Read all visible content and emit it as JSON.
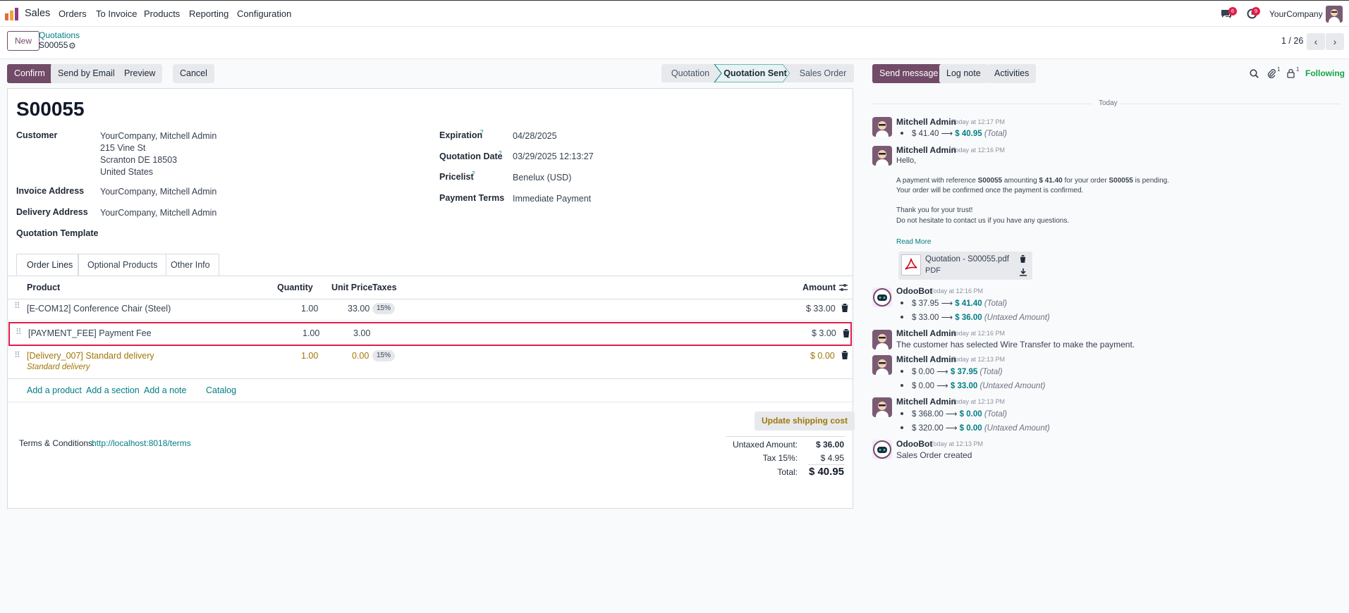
{
  "nav": {
    "app_name": "Sales",
    "menu": [
      "Orders",
      "To Invoice",
      "Products",
      "Reporting",
      "Configuration"
    ],
    "messages_badge": "6",
    "activities_badge": "9",
    "company": "YourCompany"
  },
  "control_panel": {
    "new_label": "New",
    "breadcrumb_parent": "Quotations",
    "record_name": "S00055",
    "pager": "1 / 26"
  },
  "statusbar": {
    "buttons": [
      "Confirm",
      "Send by Email",
      "Preview",
      "Cancel"
    ],
    "stages": [
      "Quotation",
      "Quotation Sent",
      "Sales Order"
    ],
    "active_stage": "Quotation Sent"
  },
  "form": {
    "title": "S00055",
    "customer_label": "Customer",
    "customer_lines": [
      "YourCompany, Mitchell Admin",
      "215 Vine St",
      "Scranton DE 18503",
      "United States"
    ],
    "invoice_address_label": "Invoice Address",
    "invoice_address": "YourCompany, Mitchell Admin",
    "delivery_address_label": "Delivery Address",
    "delivery_address": "YourCompany, Mitchell Admin",
    "quotation_template_label": "Quotation Template",
    "expiration_label": "Expiration",
    "expiration": "04/28/2025",
    "quotation_date_label": "Quotation Date",
    "quotation_date": "03/29/2025 12:13:27",
    "pricelist_label": "Pricelist",
    "pricelist": "Benelux (USD)",
    "payment_terms_label": "Payment Terms",
    "payment_terms": "Immediate Payment",
    "help_mark": "?"
  },
  "tabs": [
    "Order Lines",
    "Optional Products",
    "Other Info"
  ],
  "order_lines": {
    "headers": {
      "product": "Product",
      "quantity": "Quantity",
      "unit_price": "Unit Price",
      "taxes": "Taxes",
      "amount": "Amount"
    },
    "rows": [
      {
        "product": "[E-COM12] Conference Chair (Steel)",
        "quantity": "1.00",
        "unit_price": "33.00",
        "tax": "15%",
        "amount": "$ 33.00"
      },
      {
        "product": "[PAYMENT_FEE] Payment Fee",
        "quantity": "1.00",
        "unit_price": "3.00",
        "tax": "",
        "amount": "$ 3.00"
      },
      {
        "product": "[Delivery_007] Standard delivery",
        "description": "Standard delivery",
        "quantity": "1.00",
        "unit_price": "0.00",
        "tax": "15%",
        "amount": "$ 0.00"
      }
    ],
    "links": [
      "Add a product",
      "Add a section",
      "Add a note",
      "Catalog"
    ]
  },
  "footer": {
    "update_shipping": "Update shipping cost",
    "terms_label": "Terms & Conditions:",
    "terms_link": "http://localhost:8018/terms",
    "untaxed_label": "Untaxed Amount:",
    "untaxed": "$ 36.00",
    "tax_label": "Tax 15%:",
    "tax": "$ 4.95",
    "total_label": "Total:",
    "total": "$ 40.95"
  },
  "chatter": {
    "send_message": "Send message",
    "log_note": "Log note",
    "activities": "Activities",
    "attachments_count": "1",
    "followers_count": "1",
    "following": "Following",
    "date_separator": "Today",
    "messages": [
      {
        "author": "Mitchell Admin",
        "time": "Today at 12:17 PM",
        "tracking": [
          {
            "old": "$ 41.40",
            "new": "$ 40.95",
            "field": "(Total)"
          }
        ]
      },
      {
        "author": "Mitchell Admin",
        "time": "Today at 12:16 PM",
        "body": {
          "greeting": "Hello,",
          "p1_a": "A payment with reference ",
          "p1_ref": "S00055",
          "p1_b": " amounting ",
          "p1_amount": "$ 41.40",
          "p1_c": " for your order ",
          "p1_order": "S00055",
          "p1_d": " is pending.",
          "p2": "Your order will be confirmed once the payment is confirmed.",
          "p3": "Thank you for your trust!",
          "p4": "Do not hesitate to contact us if you have any questions.",
          "read_more": "Read More"
        },
        "attachment": {
          "name": "Quotation - S00055.pdf",
          "type": "PDF"
        }
      },
      {
        "author": "OdooBot",
        "time": "Today at 12:16 PM",
        "tracking": [
          {
            "old": "$ 37.95",
            "new": "$ 41.40",
            "field": "(Total)"
          },
          {
            "old": "$ 33.00",
            "new": "$ 36.00",
            "field": "(Untaxed Amount)"
          }
        ]
      },
      {
        "author": "Mitchell Admin",
        "time": "Today at 12:16 PM",
        "text": "The customer has selected Wire Transfer to make the payment."
      },
      {
        "author": "Mitchell Admin",
        "time": "Today at 12:13 PM",
        "tracking": [
          {
            "old": "$ 0.00",
            "new": "$ 37.95",
            "field": "(Total)"
          },
          {
            "old": "$ 0.00",
            "new": "$ 33.00",
            "field": "(Untaxed Amount)"
          }
        ]
      },
      {
        "author": "Mitchell Admin",
        "time": "Today at 12:13 PM",
        "tracking": [
          {
            "old": "$ 368.00",
            "new": "$ 0.00",
            "field": "(Total)"
          },
          {
            "old": "$ 320.00",
            "new": "$ 0.00",
            "field": "(Untaxed Amount)"
          }
        ]
      },
      {
        "author": "OdooBot",
        "time": "Today at 12:13 PM",
        "text": "Sales Order created"
      }
    ]
  },
  "colors": {
    "brand": "#714b67",
    "accent": "#017e84",
    "delivery": "#a17708",
    "highlight": "#e11d48"
  }
}
